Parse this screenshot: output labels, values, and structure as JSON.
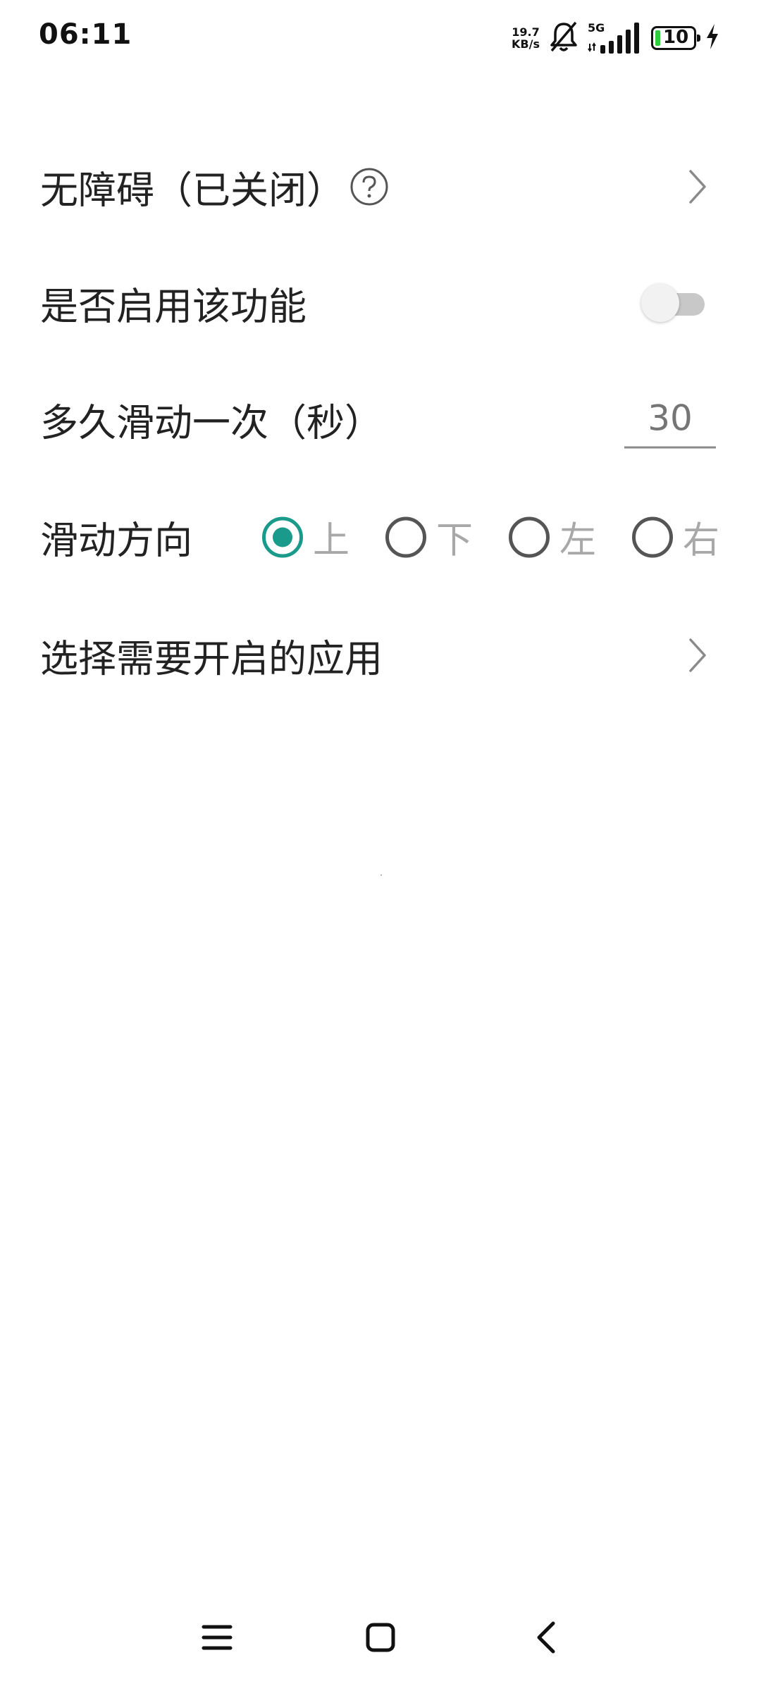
{
  "status_bar": {
    "time": "06:11",
    "net_speed_value": "19.7",
    "net_speed_unit": "KB/s",
    "network_type": "5G",
    "battery_level": "10",
    "battery_color": "#2ecc40",
    "icons": [
      "bell-off-icon",
      "signal-icon",
      "battery-icon",
      "charging-icon"
    ]
  },
  "settings": {
    "accessibility": {
      "label": "无障碍（已关闭）",
      "icons": [
        "help-icon",
        "chevron-right-icon"
      ]
    },
    "enable": {
      "label": "是否启用该功能",
      "enabled": false
    },
    "interval": {
      "label": "多久滑动一次（秒）",
      "placeholder": "30",
      "value": ""
    },
    "direction": {
      "label": "滑动方向",
      "options": [
        "上",
        "下",
        "左",
        "右"
      ],
      "selected": "上",
      "accent_color": "#1a9a8a"
    },
    "choose_apps": {
      "label": "选择需要开启的应用"
    }
  },
  "nav_bar": {
    "icons": [
      "menu-icon",
      "home-icon",
      "back-icon"
    ]
  }
}
